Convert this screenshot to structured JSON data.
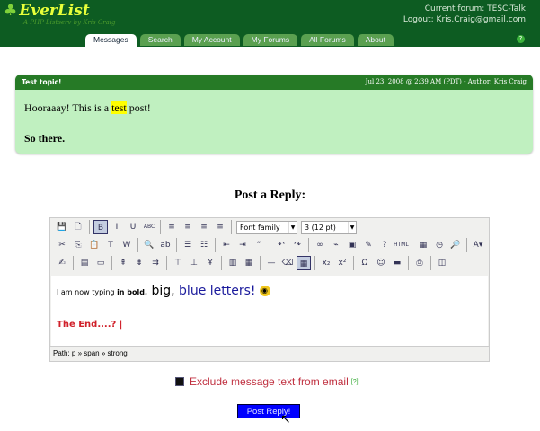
{
  "header": {
    "logo": "EverList",
    "tagline": "A PHP Listserv by Kris Craig",
    "current_forum": "Current forum: TESC-Talk",
    "logout": "Logout: Kris.Craig@gmail.com"
  },
  "tabs": [
    {
      "label": "Messages",
      "active": true
    },
    {
      "label": "Search"
    },
    {
      "label": "My Account"
    },
    {
      "label": "My Forums"
    },
    {
      "label": "All Forums"
    },
    {
      "label": "About"
    }
  ],
  "help": "?",
  "post": {
    "title": "Test topic!",
    "meta": "Jul 23, 2008 @ 2:39 AM (PDT) - Author: Kris Craig",
    "line1_a": "Hooraaay! This is a ",
    "line1_hl": "test",
    "line1_b": " post!",
    "line2": "So there."
  },
  "reply": {
    "title": "Post a Reply:",
    "font_family": "Font family",
    "font_size": "3 (12 pt)",
    "toolbar": [
      [
        [
          "save-icon",
          "💾"
        ],
        [
          "new-document-icon",
          "🗋"
        ],
        "|",
        [
          "bold-icon",
          "B",
          1
        ],
        [
          "italic-icon",
          "I"
        ],
        [
          "underline-icon",
          "U"
        ],
        [
          "strikethrough-icon",
          "ABC"
        ],
        "|",
        [
          "align-left-icon",
          "≡"
        ],
        [
          "align-center-icon",
          "≡"
        ],
        [
          "align-right-icon",
          "≡"
        ],
        [
          "align-justify-icon",
          "≡"
        ],
        "|",
        "SELECTS"
      ],
      [
        [
          "cut-icon",
          "✂"
        ],
        [
          "copy-icon",
          "⎘"
        ],
        [
          "paste-icon",
          "📋"
        ],
        [
          "paste-text-icon",
          "T"
        ],
        [
          "paste-word-icon",
          "W"
        ],
        "|",
        [
          "find-icon",
          "🔍"
        ],
        [
          "replace-icon",
          "ab"
        ],
        "|",
        [
          "bullet-list-icon",
          "☰"
        ],
        [
          "numbered-list-icon",
          "☷"
        ],
        "|",
        [
          "outdent-icon",
          "⇤"
        ],
        [
          "indent-icon",
          "⇥"
        ],
        [
          "blockquote-icon",
          "“"
        ],
        "|",
        [
          "undo-icon",
          "↶"
        ],
        [
          "redo-icon",
          "↷"
        ],
        "|",
        [
          "link-icon",
          "∞"
        ],
        [
          "unlink-icon",
          "⌁"
        ],
        [
          "image-icon",
          "▣"
        ],
        [
          "cleanup-icon",
          "✎"
        ],
        [
          "help-icon",
          "?"
        ],
        [
          "html-icon",
          "HTML"
        ],
        "|",
        [
          "insert-date-icon",
          "▦"
        ],
        [
          "insert-time-icon",
          "◷"
        ],
        [
          "preview-icon",
          "🔎"
        ],
        "|",
        [
          "text-color-icon",
          "A▾"
        ]
      ],
      [
        [
          "edit-icon",
          "✍"
        ],
        "|",
        [
          "table-icon",
          "▤"
        ],
        [
          "table-props-icon",
          "▭"
        ],
        "|",
        [
          "row-insert-icon",
          "⇞"
        ],
        [
          "row-delete-icon",
          "⇟"
        ],
        [
          "row-split-icon",
          "⇉"
        ],
        "|",
        [
          "col-before-icon",
          "⊤"
        ],
        [
          "col-after-icon",
          "⊥"
        ],
        [
          "col-delete-icon",
          "Ұ"
        ],
        "|",
        [
          "merge-cells-icon",
          "▥"
        ],
        [
          "split-cells-icon",
          "▦"
        ],
        "|",
        [
          "horizontal-rule-icon",
          "—"
        ],
        [
          "remove-format-icon",
          "⌫"
        ],
        [
          "visual-aid-icon",
          "▦",
          1
        ],
        "|",
        [
          "subscript-icon",
          "x₂"
        ],
        [
          "superscript-icon",
          "x²"
        ],
        "|",
        [
          "special-char-icon",
          "Ω"
        ],
        [
          "emoticon-icon",
          "☺"
        ],
        [
          "advanced-hr-icon",
          "▬"
        ],
        "|",
        [
          "print-icon",
          "⎙"
        ],
        "|",
        [
          "fullscreen-icon",
          "◫"
        ]
      ]
    ],
    "content": {
      "t1": "I am now typing ",
      "t2": "in bold,",
      "t3": " big,",
      "t4": " blue letters!",
      "emoticon": "😎",
      "t5": "The End....?"
    },
    "path": "Path: p » span » strong",
    "exclude_label": "Exclude message text from email",
    "exclude_help": "[?]",
    "submit": "Post Reply!"
  }
}
